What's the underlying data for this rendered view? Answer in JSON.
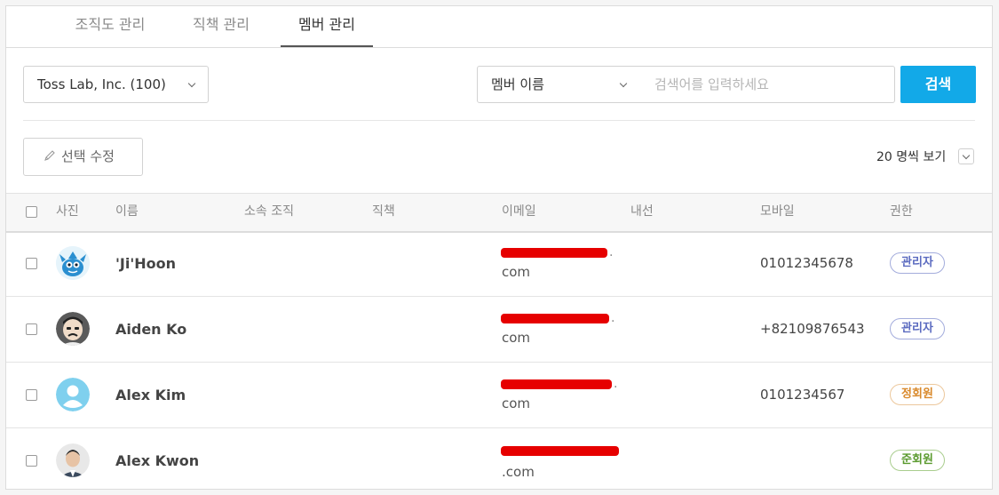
{
  "tabs": [
    {
      "label": "조직도 관리",
      "active": false
    },
    {
      "label": "직책 관리",
      "active": false
    },
    {
      "label": "멤버 관리",
      "active": true
    }
  ],
  "toolbar": {
    "org_select": "Toss Lab, Inc. (100)",
    "search_field_select": "멤버 이름",
    "search_placeholder": "검색어를 입력하세요",
    "search_button": "검색",
    "edit_button": "선택 수정",
    "per_page": "20 명씩 보기"
  },
  "table": {
    "headers": [
      "사진",
      "이름",
      "소속 조직",
      "직책",
      "이메일",
      "내선",
      "모바일",
      "권한"
    ],
    "rows": [
      {
        "name": "'Ji'Hoon",
        "email_tail": "com",
        "mobile": "01012345678",
        "role": "관리자",
        "avatar": "monster-avatar"
      },
      {
        "name": "Aiden Ko",
        "email_tail": "com",
        "mobile": "+82109876543",
        "role": "관리자",
        "avatar": "cartoon-man-avatar"
      },
      {
        "name": "Alex Kim",
        "email_tail": "com",
        "mobile": "0101234567",
        "role": "정회원",
        "avatar": "default-user-avatar"
      },
      {
        "name": "Alex Kwon",
        "email_tail": ".com",
        "mobile": "",
        "role": "준회원",
        "avatar": "photo-avatar"
      }
    ]
  },
  "colors": {
    "accent": "#12a9e8",
    "admin_badge": "#5b6bc0",
    "member_badge": "#d9892b",
    "associate_badge": "#5a9a2e",
    "redaction": "#e60000"
  }
}
